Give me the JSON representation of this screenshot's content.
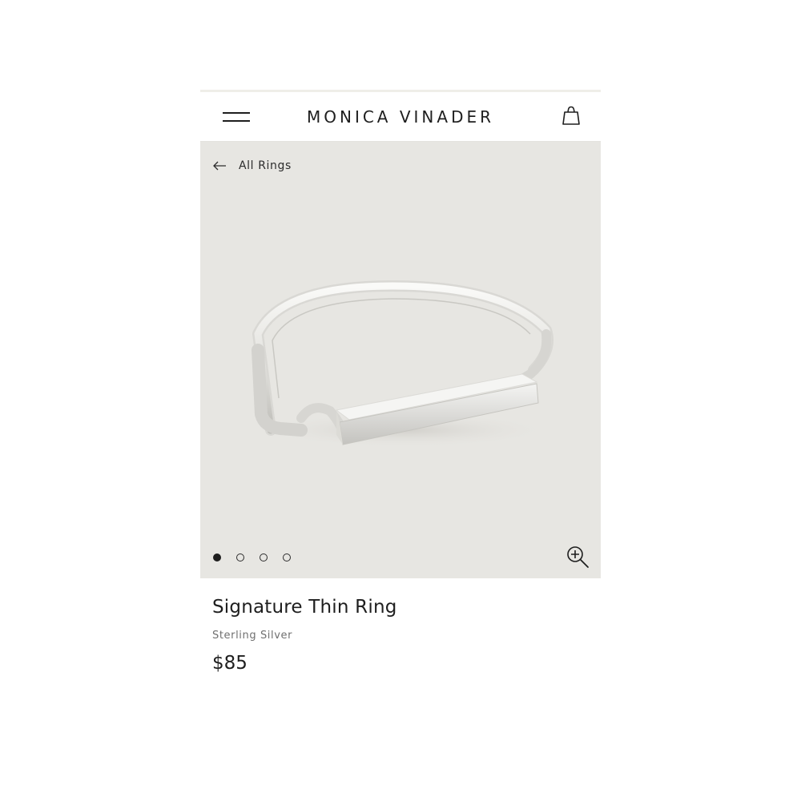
{
  "header": {
    "brand": "MONICA VINADER",
    "menu_icon": "hamburger-menu-icon",
    "bag_icon": "shopping-bag-icon"
  },
  "breadcrumb": {
    "back_icon": "arrow-left-icon",
    "label": "All Rings"
  },
  "gallery": {
    "image": "signature-thin-ring-photo",
    "total_images": 4,
    "active_index": 0,
    "zoom_icon": "zoom-in-icon"
  },
  "product": {
    "name": "Signature Thin Ring",
    "material": "Sterling Silver",
    "price": "$85"
  },
  "colors": {
    "text": "#1e1e1e",
    "muted_text": "#6f6f6f",
    "image_background": "#e7e6e2"
  }
}
